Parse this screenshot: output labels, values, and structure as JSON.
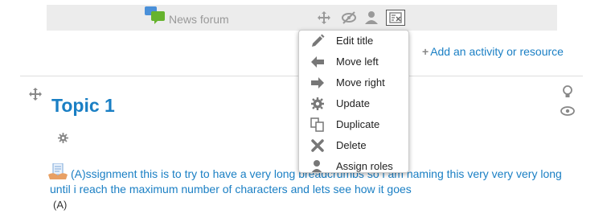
{
  "news": {
    "label": "News forum"
  },
  "add_activity": {
    "label": "Add an activity or resource"
  },
  "topic": {
    "title": "Topic 1"
  },
  "assignment": {
    "text": "(A)ssignment this is to try to have a very long breadcrumbs so i am naming this very very very long until i reach the maximum number of characters and lets see how it goes",
    "availability": "(A)"
  },
  "menu": {
    "items": [
      {
        "label": "Edit title",
        "icon": "pencil-icon"
      },
      {
        "label": "Move left",
        "icon": "arrow-left-icon"
      },
      {
        "label": "Move right",
        "icon": "arrow-right-icon"
      },
      {
        "label": "Update",
        "icon": "gear-icon"
      },
      {
        "label": "Duplicate",
        "icon": "duplicate-icon"
      },
      {
        "label": "Delete",
        "icon": "delete-icon"
      },
      {
        "label": "Assign roles",
        "icon": "user-icon"
      }
    ]
  },
  "colors": {
    "link": "#1a7fc4",
    "bar": "#ececec"
  }
}
